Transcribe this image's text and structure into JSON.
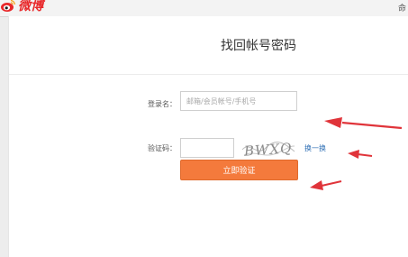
{
  "app": {
    "name": "微博",
    "brand_color": "#e8282a",
    "top_right_text": "命"
  },
  "page": {
    "title": "找回帐号密码"
  },
  "form": {
    "login_label": "登录名：",
    "login_placeholder": "邮箱/会员帐号/手机号",
    "login_value": "",
    "captcha_label": "验证码：",
    "captcha_value": "",
    "captcha_image_text": "BWXQ",
    "refresh_label": "换一换",
    "submit_label": "立即验证",
    "submit_color": "#f47a3c",
    "link_color": "#2f6fb5"
  },
  "annotations": {
    "arrow_color": "#e0343a",
    "arrows": [
      "arrow-to-login-input",
      "arrow-to-refresh-link",
      "arrow-to-submit-button"
    ]
  }
}
